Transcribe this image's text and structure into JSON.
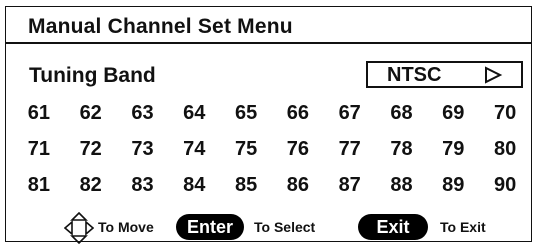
{
  "menu": {
    "title": "Manual Channel Set Menu"
  },
  "tuning_band": {
    "label": "Tuning Band",
    "value": "NTSC",
    "arrow_icon": "triangle-right-icon"
  },
  "channels": [
    [
      "61",
      "62",
      "63",
      "64",
      "65",
      "66",
      "67",
      "68",
      "69",
      "70"
    ],
    [
      "71",
      "72",
      "73",
      "74",
      "75",
      "76",
      "77",
      "78",
      "79",
      "80"
    ],
    [
      "81",
      "82",
      "83",
      "84",
      "85",
      "86",
      "87",
      "88",
      "89",
      "90"
    ]
  ],
  "footer": {
    "nav_icon": "four-way-arrow-icon",
    "move_text": "To Move",
    "enter_key": "Enter",
    "select_text": "To Select",
    "exit_key": "Exit",
    "exit_text": "To Exit"
  }
}
